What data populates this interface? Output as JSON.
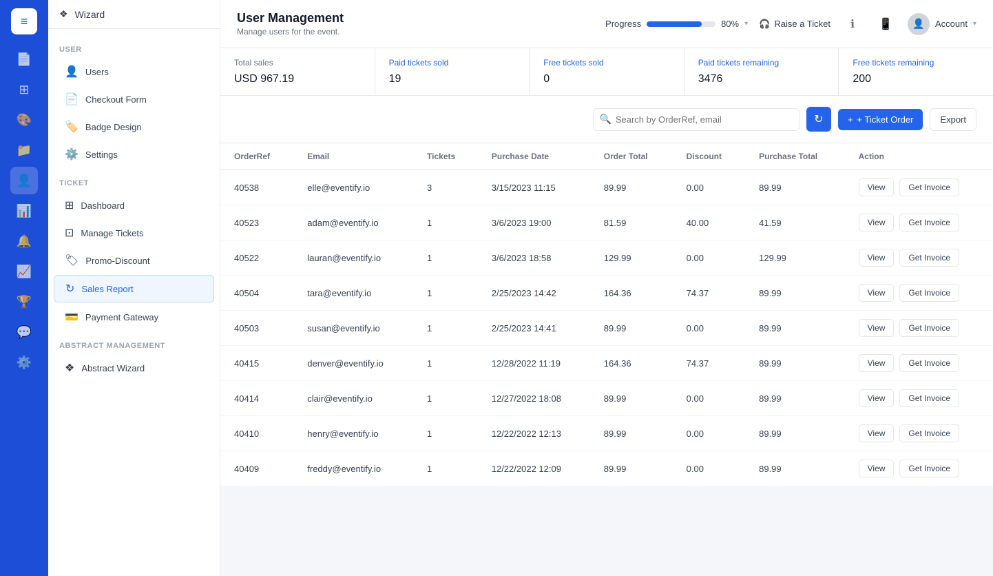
{
  "app": {
    "logo": "≡",
    "title": "User Management",
    "subtitle": "Manage users for the event."
  },
  "header": {
    "progress_label": "Progress",
    "progress_value": 80,
    "progress_pct": "80%",
    "raise_ticket_label": "Raise a Ticket",
    "account_label": "Account"
  },
  "sidebar": {
    "wizard_label": "Wizard",
    "user_section": "User",
    "user_items": [
      {
        "label": "Users",
        "icon": "👤"
      },
      {
        "label": "Checkout Form",
        "icon": "📄"
      },
      {
        "label": "Badge Design",
        "icon": "🏷️"
      },
      {
        "label": "Settings",
        "icon": "⚙️"
      }
    ],
    "ticket_section": "Ticket",
    "ticket_items": [
      {
        "label": "Dashboard",
        "icon": "⊞"
      },
      {
        "label": "Manage Tickets",
        "icon": "⊡"
      },
      {
        "label": "Promo-Discount",
        "icon": "🏷"
      },
      {
        "label": "Sales Report",
        "icon": "↻"
      },
      {
        "label": "Payment Gateway",
        "icon": "💳"
      }
    ],
    "abstract_section": "Abstract Management",
    "abstract_items": [
      {
        "label": "Abstract Wizard",
        "icon": "❖"
      }
    ]
  },
  "stats": {
    "total_sales_label": "Total sales",
    "total_sales_value": "USD 967.19",
    "paid_sold_label": "Paid tickets sold",
    "paid_sold_value": "19",
    "free_sold_label": "Free tickets sold",
    "free_sold_value": "0",
    "paid_remaining_label": "Paid tickets remaining",
    "paid_remaining_value": "3476",
    "free_remaining_label": "Free tickets remaining",
    "free_remaining_value": "200"
  },
  "toolbar": {
    "search_placeholder": "Search by OrderRef, email",
    "ticket_order_label": "+ Ticket Order",
    "export_label": "Export"
  },
  "table": {
    "columns": [
      "OrderRef",
      "Email",
      "Tickets",
      "Purchase Date",
      "Order Total",
      "Discount",
      "Purchase Total",
      "Action"
    ],
    "rows": [
      {
        "orderref": "40538",
        "email": "elle@eventify.io",
        "tickets": "3",
        "purchase_date": "3/15/2023 11:15",
        "order_total": "89.99",
        "discount": "0.00",
        "purchase_total": "89.99"
      },
      {
        "orderref": "40523",
        "email": "adam@eventify.io",
        "tickets": "1",
        "purchase_date": "3/6/2023 19:00",
        "order_total": "81.59",
        "discount": "40.00",
        "purchase_total": "41.59"
      },
      {
        "orderref": "40522",
        "email": "lauran@eventify.io",
        "tickets": "1",
        "purchase_date": "3/6/2023 18:58",
        "order_total": "129.99",
        "discount": "0.00",
        "purchase_total": "129.99"
      },
      {
        "orderref": "40504",
        "email": "tara@eventify.io",
        "tickets": "1",
        "purchase_date": "2/25/2023 14:42",
        "order_total": "164.36",
        "discount": "74.37",
        "purchase_total": "89.99"
      },
      {
        "orderref": "40503",
        "email": "susan@eventify.io",
        "tickets": "1",
        "purchase_date": "2/25/2023 14:41",
        "order_total": "89.99",
        "discount": "0.00",
        "purchase_total": "89.99"
      },
      {
        "orderref": "40415",
        "email": "denver@eventify.io",
        "tickets": "1",
        "purchase_date": "12/28/2022 11:19",
        "order_total": "164.36",
        "discount": "74.37",
        "purchase_total": "89.99"
      },
      {
        "orderref": "40414",
        "email": "clair@eventify.io",
        "tickets": "1",
        "purchase_date": "12/27/2022 18:08",
        "order_total": "89.99",
        "discount": "0.00",
        "purchase_total": "89.99"
      },
      {
        "orderref": "40410",
        "email": "henry@eventify.io",
        "tickets": "1",
        "purchase_date": "12/22/2022 12:13",
        "order_total": "89.99",
        "discount": "0.00",
        "purchase_total": "89.99"
      },
      {
        "orderref": "40409",
        "email": "freddy@eventify.io",
        "tickets": "1",
        "purchase_date": "12/22/2022 12:09",
        "order_total": "89.99",
        "discount": "0.00",
        "purchase_total": "89.99"
      }
    ],
    "view_label": "View",
    "invoice_label": "Get Invoice"
  },
  "icons": {
    "file": "📄",
    "grid": "⊞",
    "palette": "🎨",
    "folder": "📁",
    "user": "👤",
    "chart": "📊",
    "bell": "🔔",
    "bar": "📈",
    "trophy": "🏆",
    "chat": "💬",
    "cog": "⚙️",
    "refresh": "↻",
    "headphones": "🎧",
    "info": "ℹ",
    "phone": "📱"
  }
}
